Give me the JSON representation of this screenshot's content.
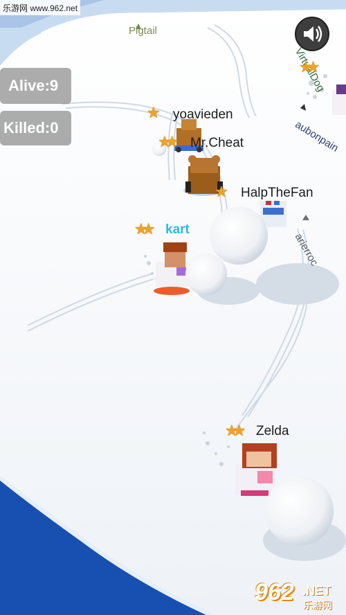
{
  "hud": {
    "alive": "Alive:9",
    "killed": "Killed:0"
  },
  "site_tag": "乐游网 www.962.net",
  "watermark": {
    "number": "962",
    "suffix": ".NET",
    "site": "乐游网"
  },
  "players": {
    "me": "kart",
    "yoavieden": "yoavieden",
    "mrcheat": "Mr.Cheat",
    "halpthefan": "HalpTheFan",
    "zelda": "Zelda"
  },
  "offscreen": {
    "pigtail": "Pigtail",
    "virtualdog": "VirtualDog",
    "aubonpain": "aubonpain",
    "arierroc": "arierroc"
  },
  "colors": {
    "me_name": "#2fb9e3",
    "star": "#f0a324",
    "ocean": "#1d5fc4",
    "snow": "#f7f9fc"
  }
}
